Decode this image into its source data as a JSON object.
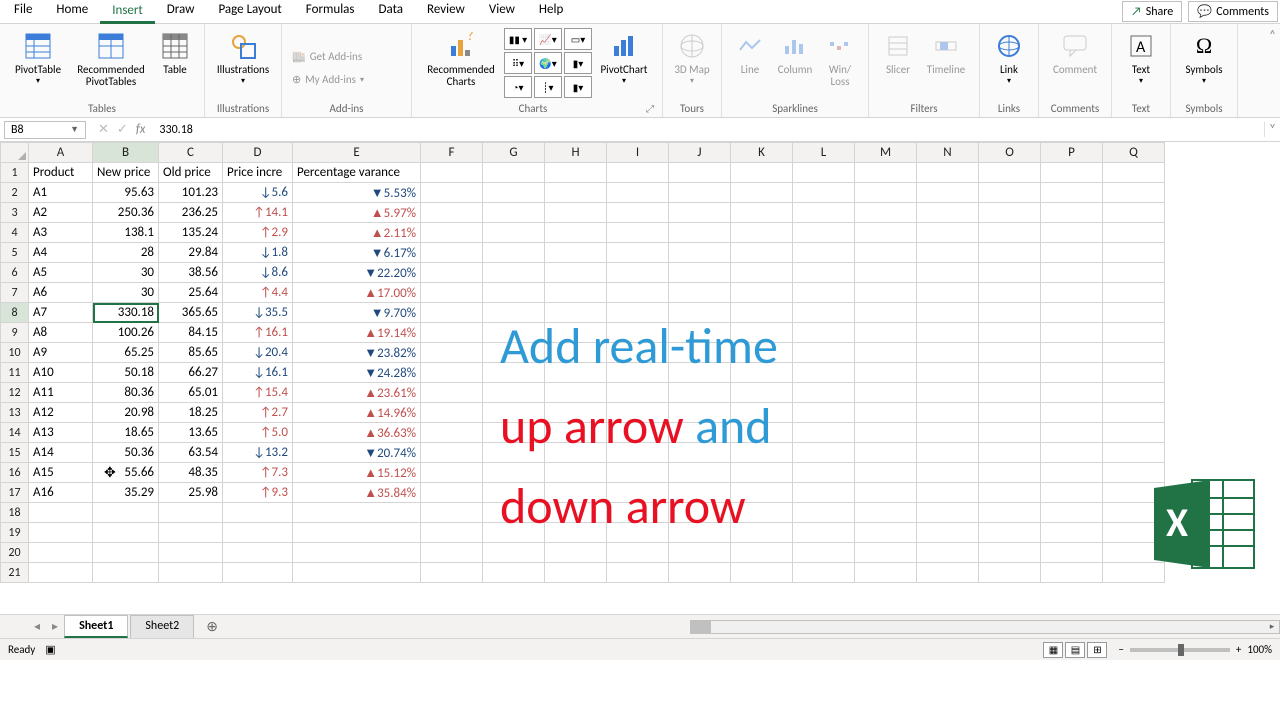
{
  "menu": {
    "items": [
      "File",
      "Home",
      "Insert",
      "Draw",
      "Page Layout",
      "Formulas",
      "Data",
      "Review",
      "View",
      "Help"
    ],
    "active": "Insert"
  },
  "share": "Share",
  "comments": "Comments",
  "ribbon": {
    "tables": {
      "label": "Tables",
      "pivot": "PivotTable",
      "recpivot": "Recommended\nPivotTables",
      "table": "Table"
    },
    "illus": {
      "label": "Illustrations",
      "btn": "Illustrations"
    },
    "addins": {
      "label": "Add-ins",
      "get": "Get Add-ins",
      "my": "My Add-ins"
    },
    "charts": {
      "label": "Charts",
      "rec": "Recommended\nCharts",
      "pivotchart": "PivotChart"
    },
    "tours": {
      "label": "Tours",
      "map": "3D\nMap"
    },
    "spark": {
      "label": "Sparklines",
      "line": "Line",
      "col": "Column",
      "wl": "Win/\nLoss"
    },
    "filters": {
      "label": "Filters",
      "slicer": "Slicer",
      "timeline": "Timeline"
    },
    "links": {
      "label": "Links",
      "link": "Link"
    },
    "commentsg": {
      "label": "Comments",
      "comment": "Comment"
    },
    "text": {
      "label": "Text",
      "btn": "Text"
    },
    "symbols": {
      "label": "Symbols",
      "btn": "Symbols"
    }
  },
  "namebox": "B8",
  "fxvalue": "330.18",
  "columns": [
    "A",
    "B",
    "C",
    "D",
    "E",
    "F",
    "G",
    "H",
    "I",
    "J",
    "K",
    "L",
    "M",
    "N",
    "O",
    "P",
    "Q"
  ],
  "headers": {
    "A": "Product",
    "B": "New price",
    "C": "Old price",
    "D": "Price incre",
    "E": "Percentage varance"
  },
  "rows": [
    {
      "p": "A1",
      "np": "95.63",
      "op": "101.23",
      "d": "↓5.6",
      "dv": -1,
      "pv": "▼5.53%",
      "pvv": -1
    },
    {
      "p": "A2",
      "np": "250.36",
      "op": "236.25",
      "d": "↑14.1",
      "dv": 1,
      "pv": "▲5.97%",
      "pvv": 1
    },
    {
      "p": "A3",
      "np": "138.1",
      "op": "135.24",
      "d": "↑2.9",
      "dv": 1,
      "pv": "▲2.11%",
      "pvv": 1
    },
    {
      "p": "A4",
      "np": "28",
      "op": "29.84",
      "d": "↓1.8",
      "dv": -1,
      "pv": "▼6.17%",
      "pvv": -1
    },
    {
      "p": "A5",
      "np": "30",
      "op": "38.56",
      "d": "↓8.6",
      "dv": -1,
      "pv": "▼22.20%",
      "pvv": -1
    },
    {
      "p": "A6",
      "np": "30",
      "op": "25.64",
      "d": "↑4.4",
      "dv": 1,
      "pv": "▲17.00%",
      "pvv": 1
    },
    {
      "p": "A7",
      "np": "330.18",
      "op": "365.65",
      "d": "↓35.5",
      "dv": -1,
      "pv": "▼9.70%",
      "pvv": -1
    },
    {
      "p": "A8",
      "np": "100.26",
      "op": "84.15",
      "d": "↑16.1",
      "dv": 1,
      "pv": "▲19.14%",
      "pvv": 1
    },
    {
      "p": "A9",
      "np": "65.25",
      "op": "85.65",
      "d": "↓20.4",
      "dv": -1,
      "pv": "▼23.82%",
      "pvv": -1
    },
    {
      "p": "A10",
      "np": "50.18",
      "op": "66.27",
      "d": "↓16.1",
      "dv": -1,
      "pv": "▼24.28%",
      "pvv": -1
    },
    {
      "p": "A11",
      "np": "80.36",
      "op": "65.01",
      "d": "↑15.4",
      "dv": 1,
      "pv": "▲23.61%",
      "pvv": 1
    },
    {
      "p": "A12",
      "np": "20.98",
      "op": "18.25",
      "d": "↑2.7",
      "dv": 1,
      "pv": "▲14.96%",
      "pvv": 1
    },
    {
      "p": "A13",
      "np": "18.65",
      "op": "13.65",
      "d": "↑5.0",
      "dv": 1,
      "pv": "▲36.63%",
      "pvv": 1
    },
    {
      "p": "A14",
      "np": "50.36",
      "op": "63.54",
      "d": "↓13.2",
      "dv": -1,
      "pv": "▼20.74%",
      "pvv": -1
    },
    {
      "p": "A15",
      "np": "55.66",
      "op": "48.35",
      "d": "↑7.3",
      "dv": 1,
      "pv": "▲15.12%",
      "pvv": 1
    },
    {
      "p": "A16",
      "np": "35.29",
      "op": "25.98",
      "d": "↑9.3",
      "dv": 1,
      "pv": "▲35.84%",
      "pvv": 1
    }
  ],
  "blankrows": [
    18,
    19,
    20,
    21
  ],
  "selected": {
    "cell": "B8",
    "row": 8,
    "col": "B"
  },
  "overlay": {
    "l1a": "Add real-time",
    "l2a": "up arrow ",
    "l2b": "and",
    "l3a": "down arrow"
  },
  "tabs": {
    "active": "Sheet1",
    "items": [
      "Sheet1",
      "Sheet2"
    ]
  },
  "status": {
    "ready": "Ready",
    "zoom": "100%"
  }
}
